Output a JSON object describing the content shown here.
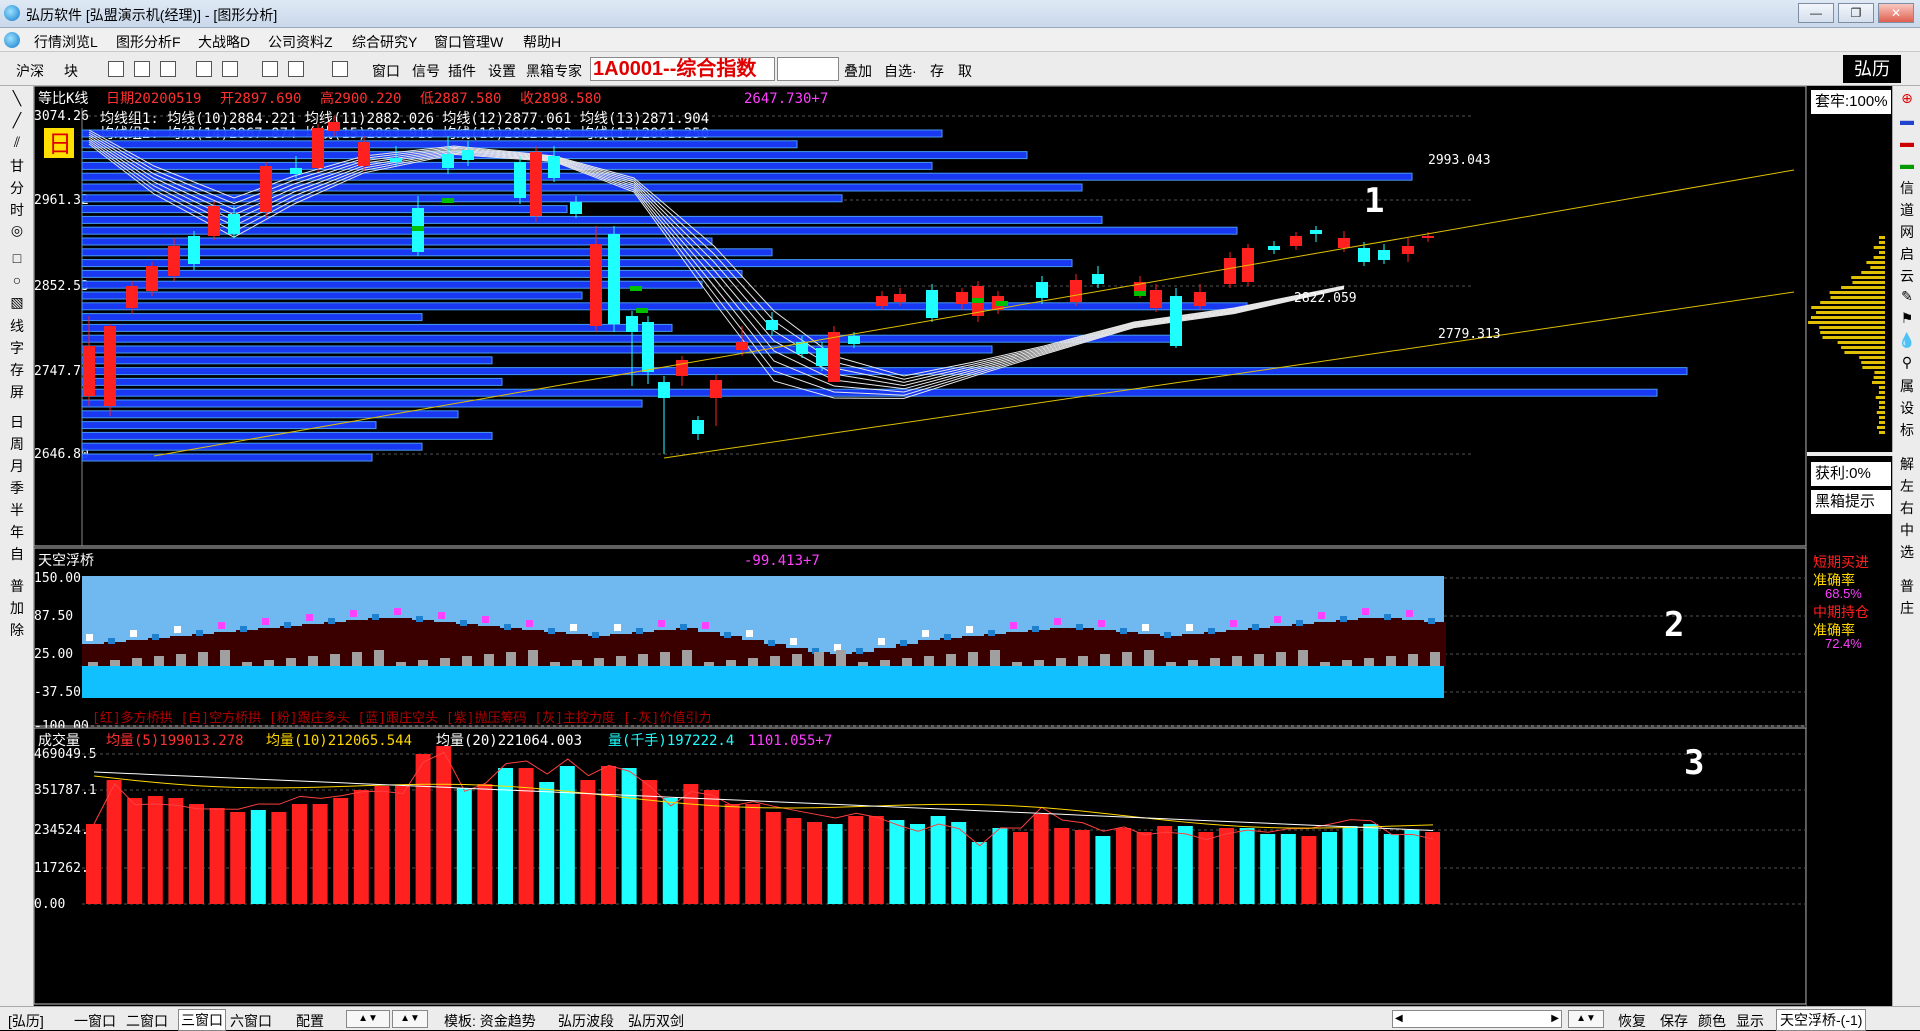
{
  "window": {
    "title": "弘历软件 [弘盟演示机(经理)] - [图形分析]",
    "controls": [
      "—",
      "❐",
      "✕"
    ]
  },
  "menu": [
    "行情浏览L",
    "图形分析F",
    "大战略D",
    "公司资料Z",
    "综合研究Y",
    "窗口管理W",
    "帮助H"
  ],
  "toolbar": {
    "items_left": [
      "沪深",
      "块"
    ],
    "items_mid": [
      "窗口",
      "信号",
      "插件",
      "设置",
      "黑箱专家"
    ],
    "stock_code": "1A0001--综合指数",
    "items_right": [
      "叠加",
      "自选·",
      "存",
      "取"
    ],
    "logo": "弘历"
  },
  "left_tools": [
    "╲",
    "╱",
    "⫽",
    "甘",
    "分",
    "时",
    "◎",
    "□",
    "○",
    "▧",
    "线",
    "字",
    "存",
    "屏",
    "日",
    "周",
    "月",
    "季",
    "半",
    "年",
    "自",
    "普",
    "加",
    "除"
  ],
  "right_tools": [
    "⊕",
    "▬",
    "▬",
    "▬",
    "信",
    "道",
    "网",
    "启",
    "云",
    "✎",
    "⚑",
    "💧",
    "⚲",
    "属",
    "设",
    "标",
    "解",
    "左",
    "右",
    "中",
    "选",
    "普",
    "庄"
  ],
  "kline": {
    "title": "等比K线",
    "date": "日期20200519",
    "open": "开2897.690",
    "high": "高2900.220",
    "low": "低2887.580",
    "close": "收2898.580",
    "cursor_value": "2647.730+7",
    "ma_line1": "均线组1: 均线(10)2884.221  均线(11)2882.026  均线(12)2877.061  均线(13)2871.904",
    "ma_line2": "均线组2: 均线(14)2867.874  均线(15)2863.918  均线(16)2862.329  均线(17)2861.250",
    "period_badge": "日",
    "y_ticks": [
      "3074.26",
      "2961.32",
      "2852.53",
      "2747.74",
      "2646.80"
    ],
    "price_labels": [
      "2993.043",
      "2822.059",
      "2779.313"
    ],
    "panel_number": "1"
  },
  "bridge": {
    "title": "天空浮桥",
    "cursor_value": "-99.413+7",
    "y_ticks": [
      "150.00",
      "87.50",
      "25.00",
      "-37.50",
      "-100.00"
    ],
    "legend": "[红]多方桥拱 [白]空方桥拱 [粉]跟庄多头 [蓝]跟庄空头 [紫]抛压筹码 [灰]主控力度 [-灰]价值引力",
    "panel_number": "2"
  },
  "volume": {
    "title": "成交量",
    "ma5": "均量(5)199013.278",
    "ma10": "均量(10)212065.544",
    "ma20": "均量(20)221064.003",
    "qty": "量(千手)197222.4",
    "cursor_value": "1101.055+7",
    "y_ticks": [
      "469049.5",
      "351787.1",
      "234524.7",
      "117262.3",
      "0.00"
    ],
    "panel_number": "3"
  },
  "side_panel": {
    "taolao": "套牢:100%",
    "huoli": "获利:0%",
    "heixiang": "黑箱提示",
    "short_buy": "短期买进",
    "accuracy1_label": "准确率",
    "accuracy1": "68.5%",
    "mid_hold": "中期持仓",
    "accuracy2_label": "准确率",
    "accuracy2": "72.4%"
  },
  "status": {
    "items": [
      "[弘历]",
      "一窗口",
      "二窗口",
      "三窗口",
      "六窗口",
      "配置",
      "模板: 资金趋势",
      "弘历波段",
      "弘历双剑",
      "恢复",
      "保存",
      "颜色",
      "显示"
    ],
    "indicator": "天空浮桥-(-1)"
  },
  "colors": {
    "up": "#ff2020",
    "down": "#20ffff",
    "blue_bar": "#1a4cff",
    "yellow": "#ffd700",
    "magenta": "#ff40ff",
    "sky": "#70b8f0"
  }
}
